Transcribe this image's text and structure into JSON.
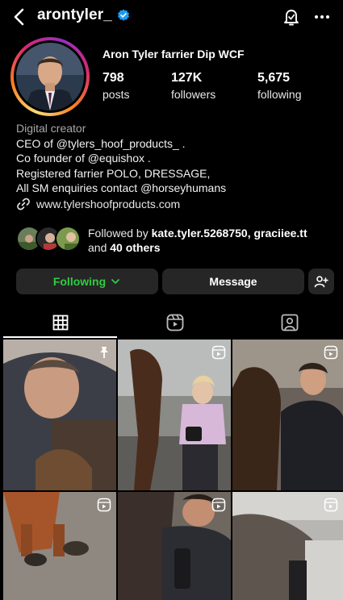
{
  "header": {
    "username": "arontyler_",
    "back_icon": "chevron-left-icon",
    "verified_icon": "verified-badge-icon",
    "bell_icon": "notification-bell-icon",
    "more_icon": "more-dots-icon"
  },
  "profile": {
    "display_name": "Aron Tyler farrier Dip WCF",
    "stats": [
      {
        "value": "798",
        "label": "posts"
      },
      {
        "value": "127K",
        "label": "followers"
      },
      {
        "value": "5,675",
        "label": "following"
      }
    ],
    "category": "Digital creator",
    "bio_lines": [
      "CEO of @tylers_hoof_products_ .",
      "Co founder of @equishox .",
      "Registered farrier POLO, DRESSAGE,",
      "All SM enquiries contact @horseyhumans"
    ],
    "website": "www.tylershoofproducts.com"
  },
  "followed_by": {
    "prefix": "Followed by",
    "names": "kate.tyler.5268750, graciiee.tt",
    "suffix_and": "and",
    "others": "40 others"
  },
  "actions": {
    "following_label": "Following",
    "message_label": "Message",
    "add_user_icon": "add-user-icon"
  },
  "tabs": [
    {
      "icon": "grid-icon",
      "active": true
    },
    {
      "icon": "reels-icon",
      "active": false
    },
    {
      "icon": "tagged-icon",
      "active": false
    }
  ],
  "colors": {
    "background": "#000000",
    "button_bg": "#262626",
    "following_green": "#2ecc40",
    "verified_blue": "#1d9bf0",
    "muted_text": "#a8a8a8"
  },
  "grid_overlay_icons": [
    "pin-icon",
    "reel-icon",
    "reel-icon",
    "reel-icon",
    "reel-icon",
    "reel-icon"
  ]
}
